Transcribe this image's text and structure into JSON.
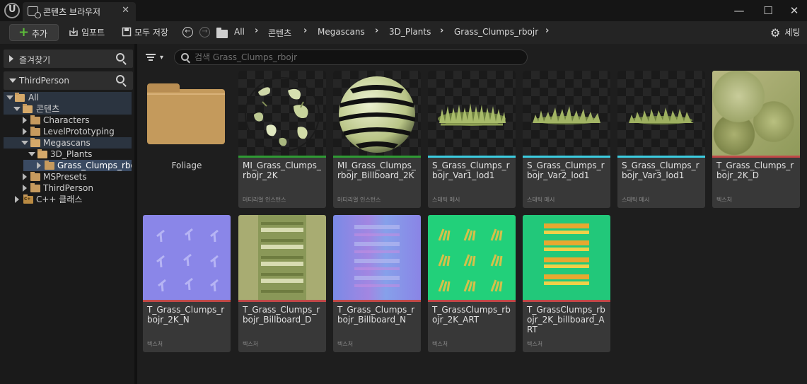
{
  "tab": {
    "title": "콘텐츠 브라우저",
    "close": "✕"
  },
  "window": {
    "minimize": "—",
    "maximize": "☐",
    "close": "✕"
  },
  "toolbar": {
    "add": "추가",
    "import": "임포트",
    "save_all": "모두 저장",
    "breadcrumb": [
      "All",
      "콘텐츠",
      "Megascans",
      "3D_Plants",
      "Grass_Clumps_rbojr"
    ],
    "settings": "세팅"
  },
  "sidebar": {
    "favorites": "즐겨찾기",
    "project": "ThirdPerson",
    "tree": [
      {
        "label": "All",
        "expanded": true,
        "state": "selected-parent"
      },
      {
        "label": "콘텐츠",
        "expanded": true,
        "state": "selected-parent"
      },
      {
        "label": "Characters",
        "expanded": false
      },
      {
        "label": "LevelPrototyping",
        "expanded": false
      },
      {
        "label": "Megascans",
        "expanded": true,
        "state": "selected-parent"
      },
      {
        "label": "3D_Plants",
        "expanded": true
      },
      {
        "label": "Grass_Clumps_rbojr",
        "expanded": false,
        "state": "selected"
      },
      {
        "label": "MSPresets",
        "expanded": false
      },
      {
        "label": "ThirdPerson",
        "expanded": false
      },
      {
        "label": "C++ 클래스",
        "expanded": false
      }
    ]
  },
  "search": {
    "placeholder": "검색 Grass_Clumps_rbojr"
  },
  "folder": {
    "name": "Foliage"
  },
  "assets": [
    {
      "name": "MI_Grass_Clumps_rbojr_2K",
      "type": "머티리얼 인스턴스",
      "bar": "#2f9a34",
      "thumb": "sphere-clumps"
    },
    {
      "name": "MI_Grass_Clumps_rbojr_Billboard_2K",
      "type": "머티리얼 인스턴스",
      "bar": "#2f9a34",
      "thumb": "sphere-billboard"
    },
    {
      "name": "S_Grass_Clumps_rbojr_Var1_lod1",
      "type": "스태틱 메시",
      "bar": "#3ccce0",
      "thumb": "grass-strip"
    },
    {
      "name": "S_Grass_Clumps_rbojr_Var2_lod1",
      "type": "스태틱 메시",
      "bar": "#3ccce0",
      "thumb": "grass-strip"
    },
    {
      "name": "S_Grass_Clumps_rbojr_Var3_lod1",
      "type": "스태틱 메시",
      "bar": "#3ccce0",
      "thumb": "grass-strip"
    },
    {
      "name": "T_Grass_Clumps_rbojr_2K_D",
      "type": "텍스처",
      "bar": "#c04848",
      "thumb": "diffuse"
    },
    {
      "name": "T_Grass_Clumps_rbojr_2K_N",
      "type": "텍스처",
      "bar": "#c04848",
      "thumb": "normal"
    },
    {
      "name": "T_Grass_Clumps_rbojr_Billboard_D",
      "type": "텍스처",
      "bar": "#c04848",
      "thumb": "billboard-diffuse"
    },
    {
      "name": "T_Grass_Clumps_rbojr_Billboard_N",
      "type": "텍스처",
      "bar": "#c04848",
      "thumb": "billboard-normal"
    },
    {
      "name": "T_GrassClumps_rbojr_2K_ART",
      "type": "텍스처",
      "bar": "#c04848",
      "thumb": "art"
    },
    {
      "name": "T_GrassClumps_rbojr_2K_billboard_ART",
      "type": "텍스처",
      "bar": "#c04848",
      "thumb": "billboard-art"
    }
  ]
}
